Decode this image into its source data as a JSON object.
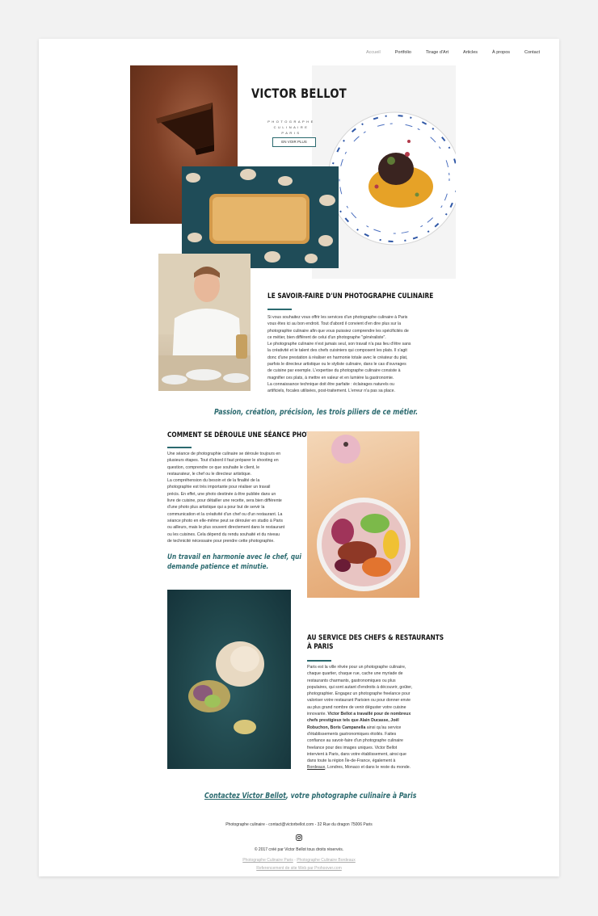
{
  "nav": {
    "items": [
      "Accueil",
      "Portfolio",
      "Tirage d'Art",
      "Articles",
      "À propos",
      "Contact"
    ]
  },
  "hero": {
    "title": "VICTOR BELLOT",
    "subtitle_line1": "PHOTOGRAPHE CULINAIRE",
    "subtitle_line2": "PARIS",
    "cta": "EN VOIR PLUS"
  },
  "savoir": {
    "title": "LE SAVOIR-FAIRE D'UN PHOTOGRAPHE CULINAIRE",
    "lines": [
      "Si vous souhaitez vous offrir les services d'un photographe culinaire à Paris",
      "vous êtes ici au bon endroit. Tout d'abord il convient d'en dire plus sur la",
      "photographie culinaire afin que vous puissiez comprendre les spécificités de",
      "ce métier, bien différent de celui d'un photographe \"généraliste\".",
      "Le photographe culinaire n'est jamais seul, son travail n'a pas lieu d'être sans",
      "la créativité et le talent des chefs cuisiniers qui composent les plats. Il s'agit",
      "donc d'une prestation à réaliser en harmonie totale avec le créateur du plat,",
      "parfois le directeur artistique ou le styliste culinaire, dans le cas d'ouvrages",
      "de cuisine par exemple. L'expertise du photographe culinaire consiste à",
      "magnifier ces plats, à mettre en valeur et en lumière la gastronomie.",
      "La connaissance technique doit être parfaite : éclairages naturels ou",
      "artificiels, focales utilisées, post-traitement. L'erreur n'a pas sa place."
    ]
  },
  "quote1": "Passion, création, précision, les trois piliers de ce métier.",
  "seance": {
    "title": "COMMENT SE DÉROULE UNE SÉANCE PHOTO ?",
    "lines": [
      "Une séance de photographie culinaire se déroule toujours en",
      "plusieurs étapes. Tout d'abord il faut préparer le shooting en",
      "question, comprendre ce que souhaite le client, le",
      "restaurateur, le chef ou le directeur artistique.",
      "La compréhension du besoin et de la finalité de la",
      "photographie est très importante pour réaliser un travail",
      "précis. En effet, une photo destinée à être publiée dans un",
      "livre de cuisine, pour détailler une recette, sera bien différente",
      "d'une photo plus artistique qui a pour but de servir la",
      "communication et la créativité d'un chef ou d'un restaurant. La",
      "séance photo en elle-même peut se dérouler en studio à Paris",
      "ou ailleurs, mais le plus souvent directement dans le restaurant",
      "ou les cuisines. Cela dépend du rendu souhaité et du niveau",
      "de technicité nécessaire pour prendre cette photographie."
    ],
    "quote_line1": "Un travail en harmonie avec le chef, qui",
    "quote_line2": "demande patience et minutie."
  },
  "service": {
    "title_line1": "AU SERVICE DES CHEFS & RESTAURANTS",
    "title_line2": "À PARIS",
    "lines": [
      "Paris est la ville rêvée pour un photographe culinaire,",
      "chaque quartier, chaque rue, cache une myriade de",
      "restaurants charmants, gastronomiques ou plus",
      "populaires, qui sont autant d'endroits à découvrir, goûter,",
      "photographier. Engagez un photographe freelance pour",
      "valoriser votre restaurant Parisien ou pour donner envie",
      "au plus grand nombre de venir déguster votre cuisine",
      "innovante."
    ],
    "bold_1": "Victor Bellot a travaillé pour de nombreux",
    "bold_2": "chefs prestigieux tels que Alain Ducasse, Joël",
    "bold_3": "Robuchon, Boris Campanella",
    "after_bold": " ainsi qu'au service",
    "lines2": [
      "d'établissements gastronomiques étoilés. Faites",
      "confiance au savoir-faire d'un photographe culinaire",
      "freelance pour des images uniques. Victor Bellot",
      "intervient à Paris, dans votre établissement, ainsi que",
      "dans toute la région Île-de-France, également à"
    ],
    "last_link": "Bordeaux",
    "last_rest": ", Londres, Monaco et dans le reste du monde."
  },
  "contact": {
    "link": "Contactez Victor Bellot",
    "rest": ", votre photographe culinaire à Paris"
  },
  "footer": {
    "line1": "Photographe culinaire - contact@victorbellot.com - 32 Rue du dragon 75006 Paris",
    "copyright": "© 2017 créé par Victor Bellot tous droits réservés.",
    "link1": "Photographe Culinaire Paris",
    "sep": " - ",
    "link2": "Photographe Culinaire Bordeaux",
    "link3": "Referencement de site Web par Prohoover.com"
  },
  "colors": {
    "accent": "#2b6a6f",
    "background": "#f2f2f2",
    "page": "#ffffff"
  },
  "icons": [
    "instagram-icon"
  ]
}
